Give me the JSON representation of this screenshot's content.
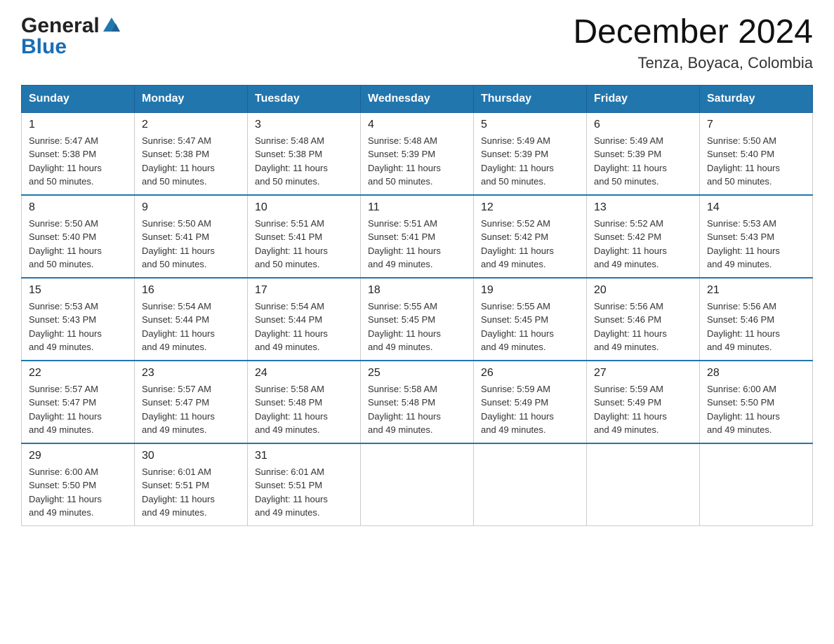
{
  "logo": {
    "general": "General",
    "blue": "Blue"
  },
  "title": "December 2024",
  "subtitle": "Tenza, Boyaca, Colombia",
  "days_of_week": [
    "Sunday",
    "Monday",
    "Tuesday",
    "Wednesday",
    "Thursday",
    "Friday",
    "Saturday"
  ],
  "weeks": [
    [
      {
        "day": "1",
        "sunrise": "5:47 AM",
        "sunset": "5:38 PM",
        "daylight": "11 hours and 50 minutes."
      },
      {
        "day": "2",
        "sunrise": "5:47 AM",
        "sunset": "5:38 PM",
        "daylight": "11 hours and 50 minutes."
      },
      {
        "day": "3",
        "sunrise": "5:48 AM",
        "sunset": "5:38 PM",
        "daylight": "11 hours and 50 minutes."
      },
      {
        "day": "4",
        "sunrise": "5:48 AM",
        "sunset": "5:39 PM",
        "daylight": "11 hours and 50 minutes."
      },
      {
        "day": "5",
        "sunrise": "5:49 AM",
        "sunset": "5:39 PM",
        "daylight": "11 hours and 50 minutes."
      },
      {
        "day": "6",
        "sunrise": "5:49 AM",
        "sunset": "5:39 PM",
        "daylight": "11 hours and 50 minutes."
      },
      {
        "day": "7",
        "sunrise": "5:50 AM",
        "sunset": "5:40 PM",
        "daylight": "11 hours and 50 minutes."
      }
    ],
    [
      {
        "day": "8",
        "sunrise": "5:50 AM",
        "sunset": "5:40 PM",
        "daylight": "11 hours and 50 minutes."
      },
      {
        "day": "9",
        "sunrise": "5:50 AM",
        "sunset": "5:41 PM",
        "daylight": "11 hours and 50 minutes."
      },
      {
        "day": "10",
        "sunrise": "5:51 AM",
        "sunset": "5:41 PM",
        "daylight": "11 hours and 50 minutes."
      },
      {
        "day": "11",
        "sunrise": "5:51 AM",
        "sunset": "5:41 PM",
        "daylight": "11 hours and 49 minutes."
      },
      {
        "day": "12",
        "sunrise": "5:52 AM",
        "sunset": "5:42 PM",
        "daylight": "11 hours and 49 minutes."
      },
      {
        "day": "13",
        "sunrise": "5:52 AM",
        "sunset": "5:42 PM",
        "daylight": "11 hours and 49 minutes."
      },
      {
        "day": "14",
        "sunrise": "5:53 AM",
        "sunset": "5:43 PM",
        "daylight": "11 hours and 49 minutes."
      }
    ],
    [
      {
        "day": "15",
        "sunrise": "5:53 AM",
        "sunset": "5:43 PM",
        "daylight": "11 hours and 49 minutes."
      },
      {
        "day": "16",
        "sunrise": "5:54 AM",
        "sunset": "5:44 PM",
        "daylight": "11 hours and 49 minutes."
      },
      {
        "day": "17",
        "sunrise": "5:54 AM",
        "sunset": "5:44 PM",
        "daylight": "11 hours and 49 minutes."
      },
      {
        "day": "18",
        "sunrise": "5:55 AM",
        "sunset": "5:45 PM",
        "daylight": "11 hours and 49 minutes."
      },
      {
        "day": "19",
        "sunrise": "5:55 AM",
        "sunset": "5:45 PM",
        "daylight": "11 hours and 49 minutes."
      },
      {
        "day": "20",
        "sunrise": "5:56 AM",
        "sunset": "5:46 PM",
        "daylight": "11 hours and 49 minutes."
      },
      {
        "day": "21",
        "sunrise": "5:56 AM",
        "sunset": "5:46 PM",
        "daylight": "11 hours and 49 minutes."
      }
    ],
    [
      {
        "day": "22",
        "sunrise": "5:57 AM",
        "sunset": "5:47 PM",
        "daylight": "11 hours and 49 minutes."
      },
      {
        "day": "23",
        "sunrise": "5:57 AM",
        "sunset": "5:47 PM",
        "daylight": "11 hours and 49 minutes."
      },
      {
        "day": "24",
        "sunrise": "5:58 AM",
        "sunset": "5:48 PM",
        "daylight": "11 hours and 49 minutes."
      },
      {
        "day": "25",
        "sunrise": "5:58 AM",
        "sunset": "5:48 PM",
        "daylight": "11 hours and 49 minutes."
      },
      {
        "day": "26",
        "sunrise": "5:59 AM",
        "sunset": "5:49 PM",
        "daylight": "11 hours and 49 minutes."
      },
      {
        "day": "27",
        "sunrise": "5:59 AM",
        "sunset": "5:49 PM",
        "daylight": "11 hours and 49 minutes."
      },
      {
        "day": "28",
        "sunrise": "6:00 AM",
        "sunset": "5:50 PM",
        "daylight": "11 hours and 49 minutes."
      }
    ],
    [
      {
        "day": "29",
        "sunrise": "6:00 AM",
        "sunset": "5:50 PM",
        "daylight": "11 hours and 49 minutes."
      },
      {
        "day": "30",
        "sunrise": "6:01 AM",
        "sunset": "5:51 PM",
        "daylight": "11 hours and 49 minutes."
      },
      {
        "day": "31",
        "sunrise": "6:01 AM",
        "sunset": "5:51 PM",
        "daylight": "11 hours and 49 minutes."
      },
      null,
      null,
      null,
      null
    ]
  ],
  "labels": {
    "sunrise": "Sunrise:",
    "sunset": "Sunset:",
    "daylight": "Daylight:"
  },
  "accent_color": "#2176ae"
}
